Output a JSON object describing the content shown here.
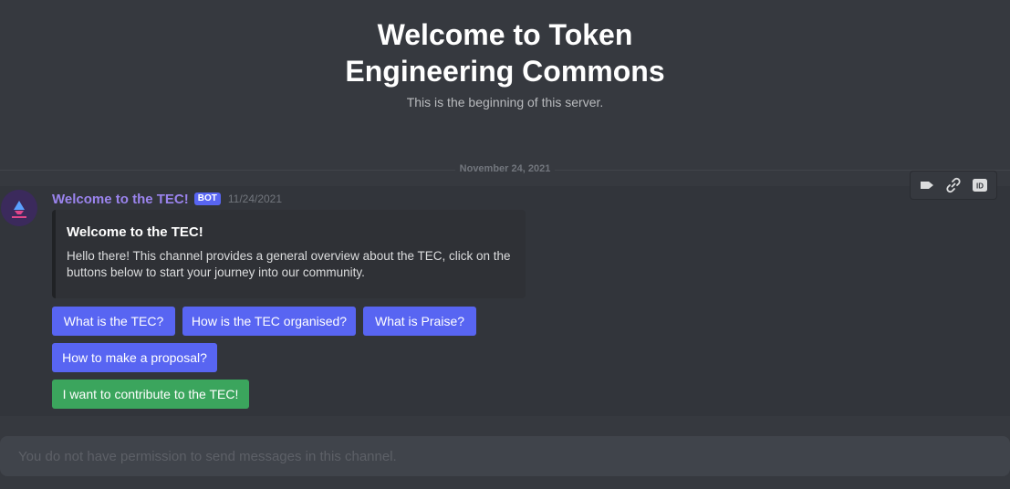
{
  "welcome": {
    "title": "Welcome to Token Engineering Commons",
    "subtitle": "This is the beginning of this server."
  },
  "divider": {
    "date": "November 24, 2021"
  },
  "message": {
    "username": "Welcome to the TEC!",
    "tag": "BOT",
    "timestamp": "11/24/2021",
    "avatar_icon": "tec-logo-icon",
    "embed": {
      "title": "Welcome to the TEC!",
      "description": "Hello there! This channel provides a general overview about the TEC, click on the buttons below to start your journey into our community."
    },
    "buttons": [
      {
        "label": "What is the TEC?",
        "style": "primary"
      },
      {
        "label": "How is the TEC organised?",
        "style": "primary"
      },
      {
        "label": "What is Praise?",
        "style": "primary"
      },
      {
        "label": "How to make a proposal?",
        "style": "primary"
      },
      {
        "label": "I want to contribute to the TEC!",
        "style": "success"
      }
    ]
  },
  "toolbar": {
    "icons": [
      "tag-icon",
      "link-icon",
      "id-icon"
    ]
  },
  "composer": {
    "placeholder": "You do not have permission to send messages in this channel."
  },
  "colors": {
    "background": "#36393f",
    "blurple": "#5865f2",
    "green": "#3ba55d",
    "username": "#9b84ee"
  }
}
